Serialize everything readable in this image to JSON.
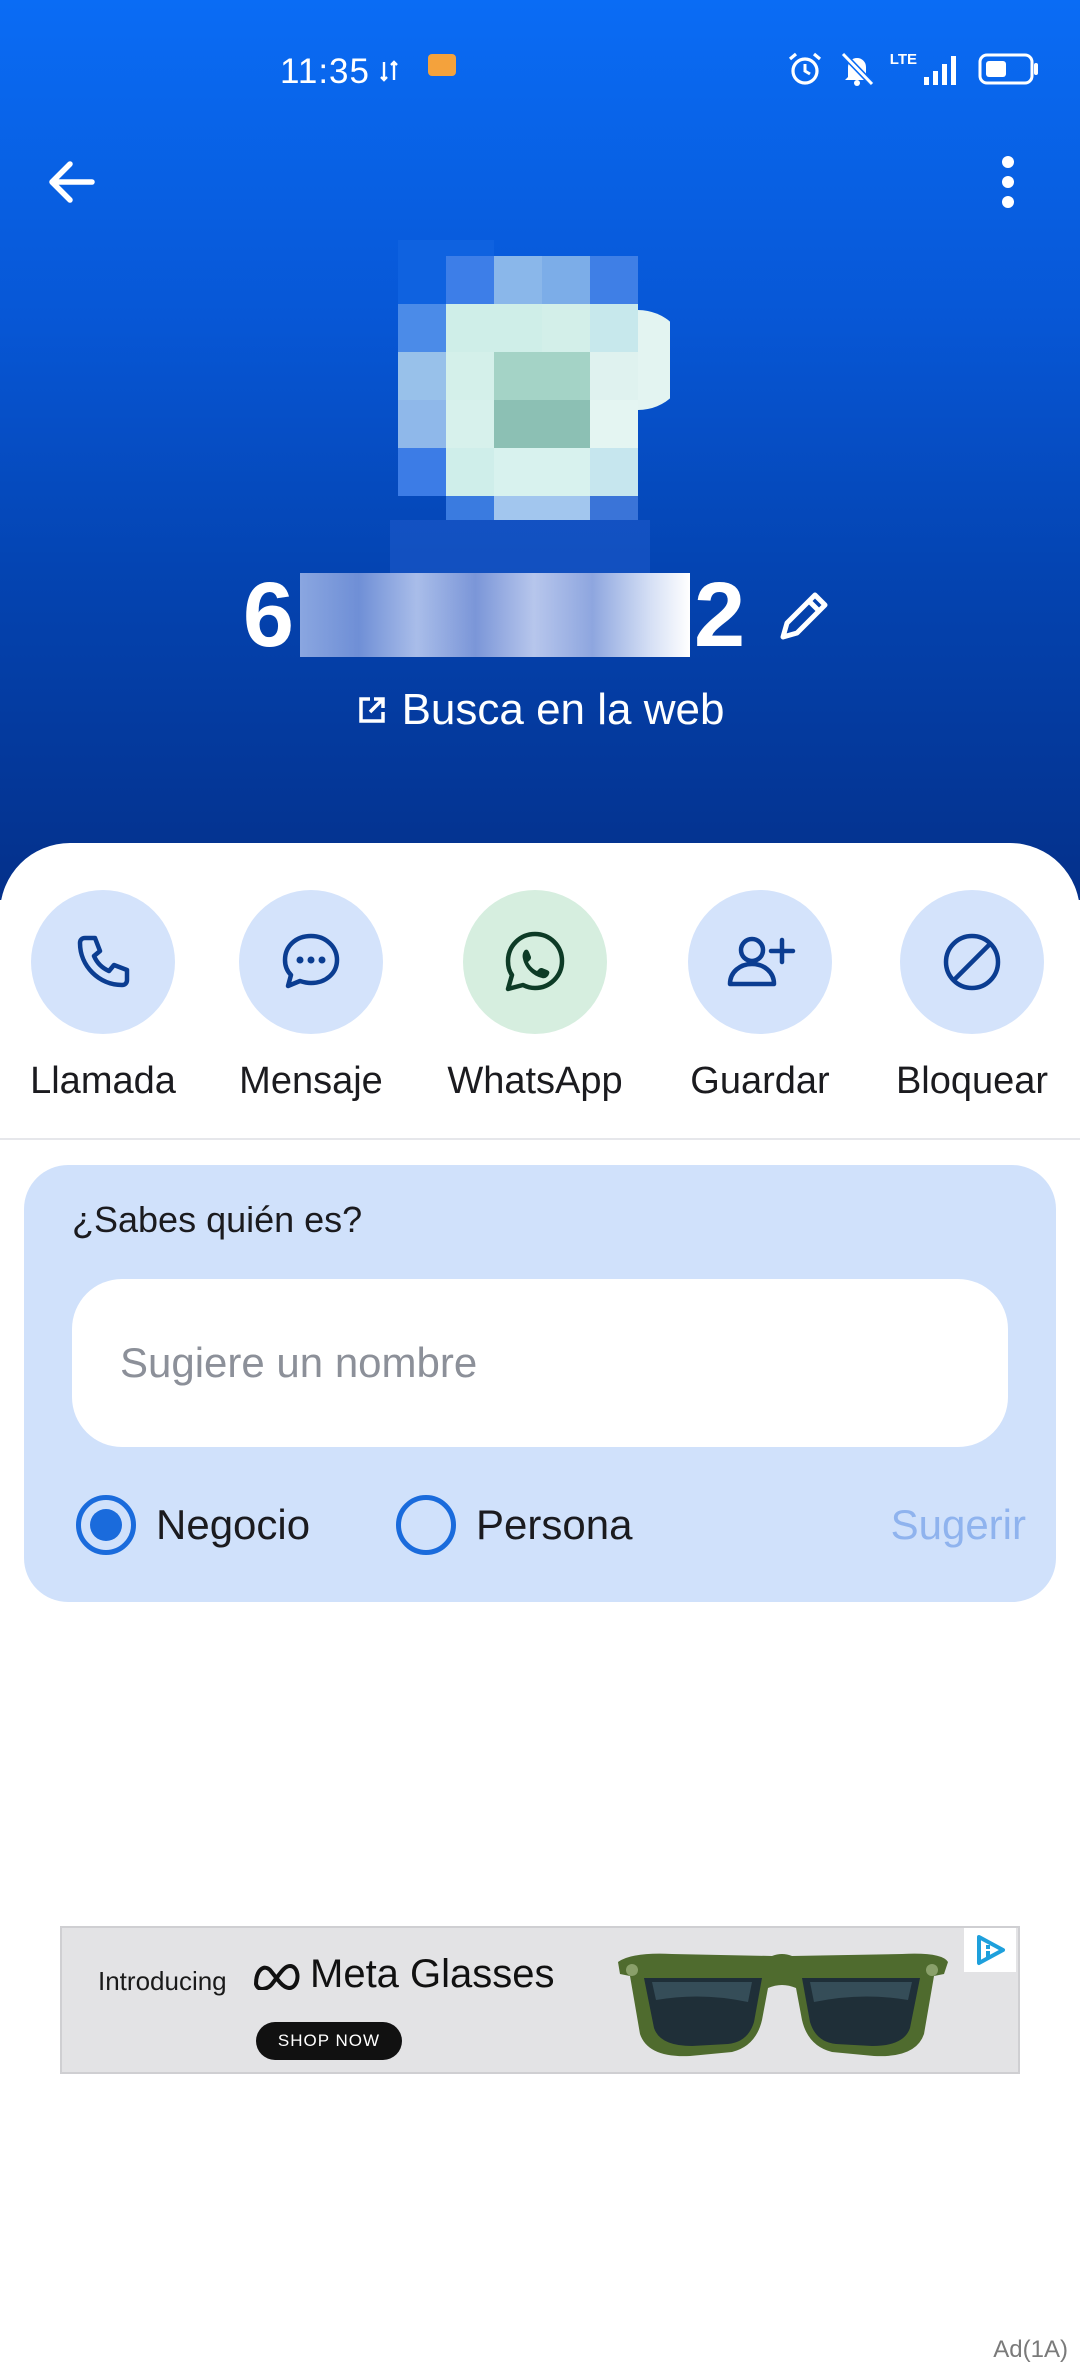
{
  "status_bar": {
    "time": "11:35",
    "network": "LTE"
  },
  "contact": {
    "phone_start": "6",
    "phone_end": "2",
    "search_web_label": "Busca en la web"
  },
  "actions": [
    {
      "label": "Llamada",
      "icon": "phone-icon"
    },
    {
      "label": "Mensaje",
      "icon": "message-icon"
    },
    {
      "label": "WhatsApp",
      "icon": "whatsapp-icon"
    },
    {
      "label": "Guardar",
      "icon": "add-person-icon"
    },
    {
      "label": "Bloquear",
      "icon": "block-icon"
    }
  ],
  "suggestion": {
    "title": "¿Sabes quién es?",
    "input_placeholder": "Sugiere un nombre",
    "options": [
      {
        "label": "Negocio",
        "selected": true
      },
      {
        "label": "Persona",
        "selected": false
      }
    ],
    "submit_label": "Sugerir"
  },
  "ad": {
    "intro": "Introducing",
    "brand": "Meta Glasses",
    "cta": "SHOP NOW",
    "label": "Ad(1A)"
  },
  "colors": {
    "header_top": "#0a6cf5",
    "header_bottom": "#04308a",
    "action_circle": "#d4e3fb",
    "whatsapp_circle": "#d6eedf",
    "card_bg": "#d0e1fb",
    "accent": "#1a6bdc",
    "icon_dark": "#0b3d91"
  }
}
